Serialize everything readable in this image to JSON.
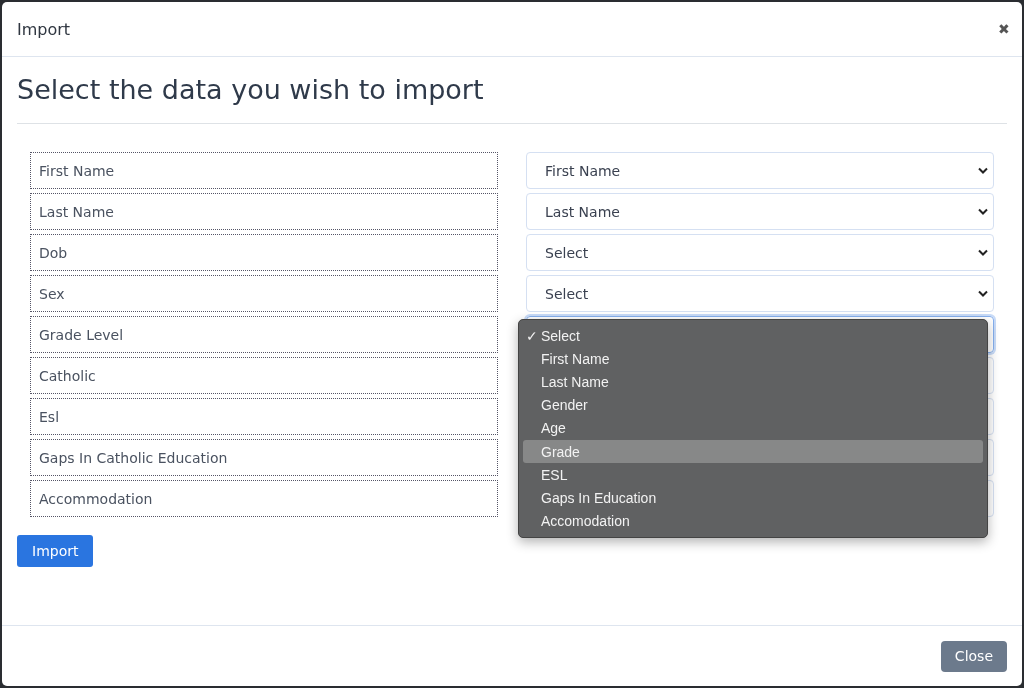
{
  "dialog": {
    "title": "Import",
    "close_icon": "✖"
  },
  "heading": "Select the data you wish to import",
  "rows": [
    {
      "field": "First Name",
      "select": {
        "value": "First Name",
        "focused": false
      }
    },
    {
      "field": "Last Name",
      "select": {
        "value": "Last Name",
        "focused": false
      }
    },
    {
      "field": "Dob",
      "select": {
        "value": "Select",
        "focused": false
      }
    },
    {
      "field": "Sex",
      "select": {
        "value": "Select",
        "focused": false
      }
    },
    {
      "field": "Grade Level",
      "select": {
        "focused": true
      }
    },
    {
      "field": "Catholic",
      "select": {
        "focused": false
      }
    },
    {
      "field": "Esl",
      "select": {
        "focused": false
      }
    },
    {
      "field": "Gaps In Catholic Education",
      "select": {
        "focused": false
      }
    },
    {
      "field": "Accommodation",
      "select": {
        "focused": false
      }
    }
  ],
  "dropdown": {
    "check_mark": "✓",
    "options": [
      {
        "label": "Select",
        "selected": true,
        "highlighted": false
      },
      {
        "label": "First Name",
        "selected": false,
        "highlighted": false
      },
      {
        "label": "Last Name",
        "selected": false,
        "highlighted": false
      },
      {
        "label": "Gender",
        "selected": false,
        "highlighted": false
      },
      {
        "label": "Age",
        "selected": false,
        "highlighted": false
      },
      {
        "label": "Grade",
        "selected": false,
        "highlighted": true
      },
      {
        "label": "ESL",
        "selected": false,
        "highlighted": false
      },
      {
        "label": "Gaps In Education",
        "selected": false,
        "highlighted": false
      },
      {
        "label": "Accomodation",
        "selected": false,
        "highlighted": false
      }
    ]
  },
  "import_button": "Import",
  "footer": {
    "close_button": "Close"
  }
}
